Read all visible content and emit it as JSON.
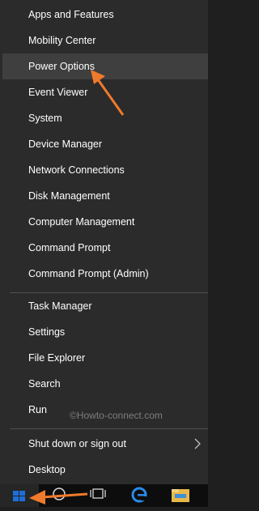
{
  "menu": {
    "items": [
      {
        "label": "Apps and Features"
      },
      {
        "label": "Mobility Center"
      },
      {
        "label": "Power Options"
      },
      {
        "label": "Event Viewer"
      },
      {
        "label": "System"
      },
      {
        "label": "Device Manager"
      },
      {
        "label": "Network Connections"
      },
      {
        "label": "Disk Management"
      },
      {
        "label": "Computer Management"
      },
      {
        "label": "Command Prompt"
      },
      {
        "label": "Command Prompt (Admin)"
      },
      {
        "label": "Task Manager"
      },
      {
        "label": "Settings"
      },
      {
        "label": "File Explorer"
      },
      {
        "label": "Search"
      },
      {
        "label": "Run"
      },
      {
        "label": "Shut down or sign out"
      },
      {
        "label": "Desktop"
      }
    ]
  },
  "watermark": "©Howto-connect.com",
  "colors": {
    "menu_bg": "#2b2b2b",
    "highlight_bg": "#3f3f3f",
    "arrow": "#f07a2b",
    "windows_blue": "#1e6fd9",
    "edge_blue": "#2a8be8",
    "explorer_yellow": "#e8b84a"
  },
  "taskbar": {
    "icons": [
      "windows-logo-icon",
      "search-circle-icon",
      "task-view-icon",
      "edge-icon",
      "file-explorer-icon"
    ]
  }
}
